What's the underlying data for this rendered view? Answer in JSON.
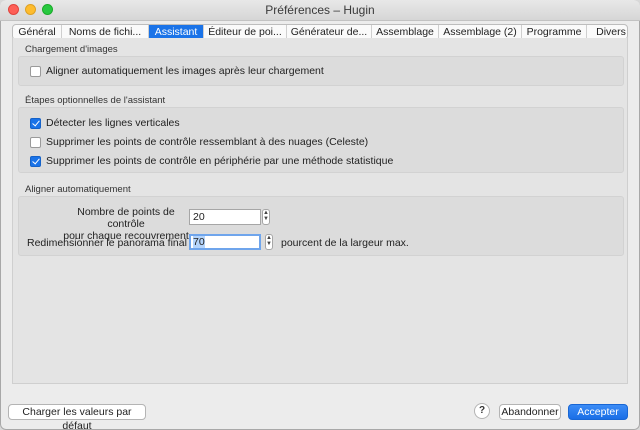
{
  "window": {
    "title": "Préférences – Hugin"
  },
  "tabs": [
    {
      "label": "Général"
    },
    {
      "label": "Noms de fichi..."
    },
    {
      "label": "Assistant"
    },
    {
      "label": "Éditeur de poi..."
    },
    {
      "label": "Générateur de..."
    },
    {
      "label": "Assemblage"
    },
    {
      "label": "Assemblage (2)"
    },
    {
      "label": "Programme"
    },
    {
      "label": "Divers"
    }
  ],
  "sections": {
    "loading": {
      "title": "Chargement d'images",
      "auto_align": {
        "label": "Aligner automatiquement les images après leur chargement",
        "checked": false
      }
    },
    "optional_steps": {
      "title": "Étapes optionnelles de l'assistant",
      "items": [
        {
          "label": "Détecter les lignes verticales",
          "checked": true
        },
        {
          "label": "Supprimer les points de contrôle ressemblant à des nuages (Celeste)",
          "checked": false
        },
        {
          "label": "Supprimer les points de contrôle en périphérie par une méthode statistique",
          "checked": true
        }
      ]
    },
    "auto_align": {
      "title": "Aligner automatiquement",
      "cp_label_line1": "Nombre de points de contrôle",
      "cp_label_line2": "pour chaque recouvrement",
      "cp_value": "20",
      "resize_label": "Redimensionner le panorama final à",
      "resize_value": "70",
      "resize_suffix": "pourcent de la largeur max."
    }
  },
  "footer": {
    "defaults_label": "Charger les valeurs par défaut",
    "help_label": "?",
    "cancel_label": "Abandonner",
    "accept_label": "Accepter"
  },
  "colors": {
    "accent": "#1a73e8"
  }
}
